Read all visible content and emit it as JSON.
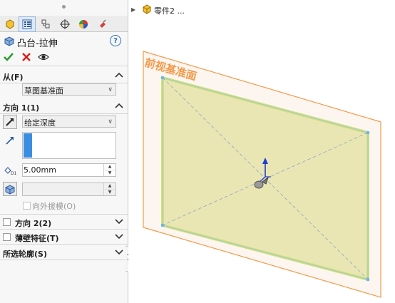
{
  "property_manager": {
    "feature_title": "凸台-拉伸",
    "icons": {
      "feature": "boss-extrude-icon",
      "help": "help-icon",
      "ok": "check-icon",
      "cancel": "cross-icon",
      "preview": "eye-icon"
    },
    "help_label": "?",
    "tabs": [
      {
        "icon": "feature-manager-icon"
      },
      {
        "icon": "property-manager-icon",
        "active": true
      },
      {
        "icon": "configuration-manager-icon"
      },
      {
        "icon": "dimxpert-icon"
      },
      {
        "icon": "display-manager-icon"
      },
      {
        "icon": "cam-icon"
      }
    ],
    "from_section": {
      "label": "从(F)",
      "value": "草图基准面"
    },
    "direction1": {
      "label": "方向 1(1)",
      "end_condition": "给定深度",
      "depth": "5.00mm",
      "draft_outward_label": "向外拔模(O)"
    },
    "direction2": {
      "label": "方向 2(2)"
    },
    "thin_feature": {
      "label": "薄壁特征(T)"
    },
    "selected_contours": {
      "label": "所选轮廓(S)"
    }
  },
  "graphics_area": {
    "tree_item": "零件2 ...",
    "plane_label": "前视基准面",
    "colors": {
      "plane_outline": "#f39a4a",
      "plane_text": "#f39a4a",
      "preview_fill": "#e6e3a8",
      "preview_edge": "#e8ef60",
      "axis": "#1b3fd6"
    }
  }
}
